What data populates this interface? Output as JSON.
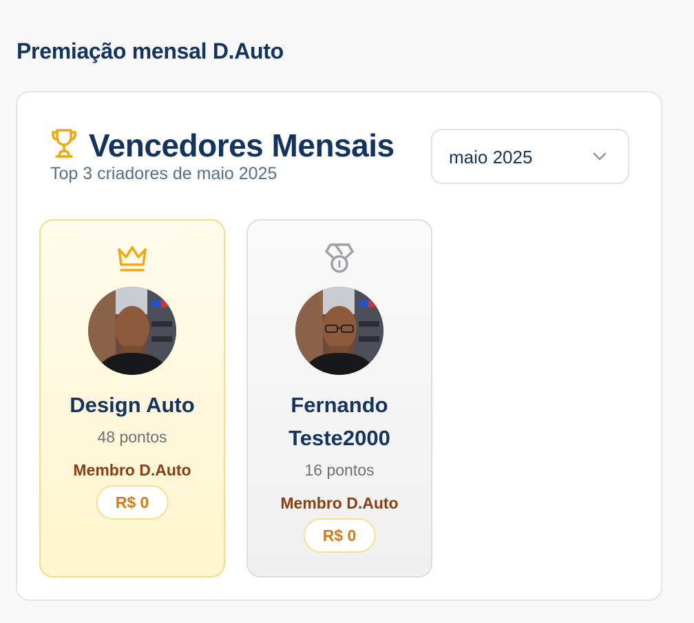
{
  "page": {
    "title": "Premiação mensal D.Auto"
  },
  "panel": {
    "title": "Vencedores Mensais",
    "subtitle": "Top 3 criadores de maio 2025",
    "header_icon": "trophy-icon"
  },
  "month_selector": {
    "value": "maio 2025",
    "icon": "chevron-down-icon"
  },
  "colors": {
    "primary": "#12345e",
    "gold_accent": "#f3a70f",
    "silver_accent": "#9fa0a8",
    "member_text": "#8b3f10",
    "prize_text": "#d27c17"
  },
  "winners": [
    {
      "rank": 1,
      "rank_icon": "crown-icon",
      "name": "Design Auto",
      "points": "48 pontos",
      "membership": "Membro D.Auto",
      "prize": "R$ 0"
    },
    {
      "rank": 2,
      "rank_icon": "medal-icon",
      "name": "Fernando Teste2000",
      "points": "16 pontos",
      "membership": "Membro D.Auto",
      "prize": "R$ 0"
    }
  ]
}
